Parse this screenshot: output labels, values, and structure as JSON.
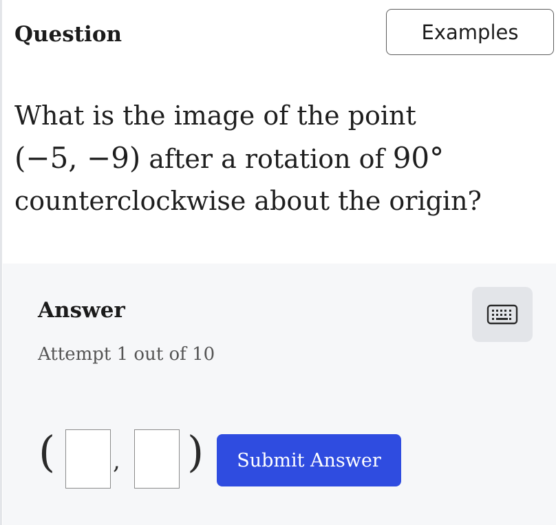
{
  "header": {
    "title": "Question",
    "examples_label": "Examples"
  },
  "question": {
    "line1": "What is the image of the point",
    "point": "(−5, −9)",
    "line2_mid": " after a rotation of ",
    "angle": "90°",
    "line3": "counterclockwise about the origin?"
  },
  "answer": {
    "title": "Answer",
    "attempt": "Attempt 1 out of 10",
    "keyboard_icon": "keyboard-icon",
    "open_paren": "(",
    "comma": ",",
    "close_paren": ")",
    "x_value": "",
    "y_value": "",
    "submit_label": "Submit Answer"
  },
  "colors": {
    "accent": "#2f4ce0",
    "panel_bg": "#f6f7f9",
    "keyboard_btn_bg": "#e3e5e9"
  }
}
